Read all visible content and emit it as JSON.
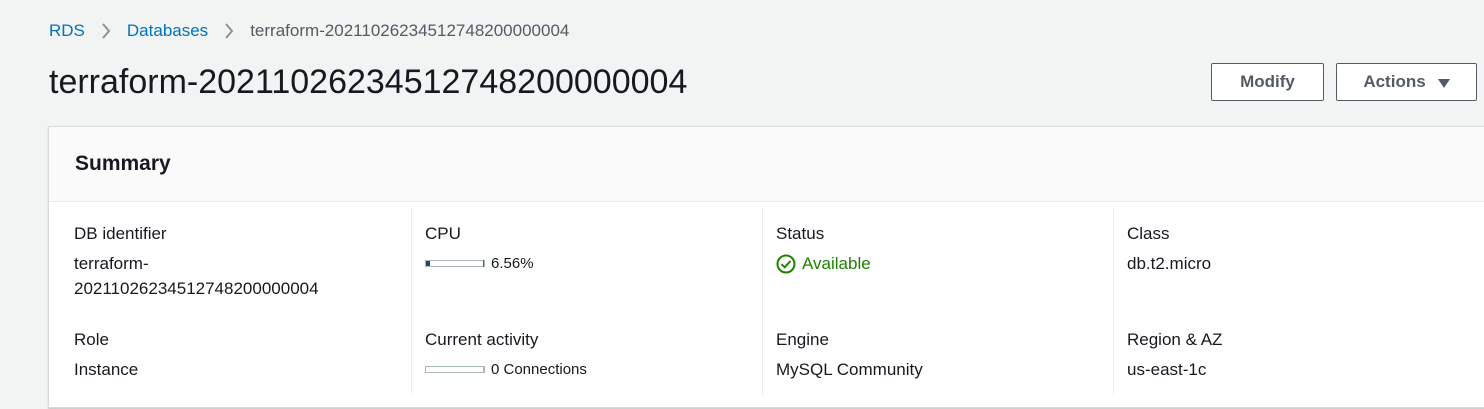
{
  "breadcrumb": {
    "items": [
      {
        "label": "RDS"
      },
      {
        "label": "Databases"
      },
      {
        "label": "terraform-20211026234512748200000004"
      }
    ]
  },
  "page": {
    "title": "terraform-20211026234512748200000004"
  },
  "toolbar": {
    "modify_label": "Modify",
    "actions_label": "Actions"
  },
  "summary": {
    "title": "Summary",
    "db_identifier": {
      "label": "DB identifier",
      "value": "terraform-\n20211026234512748200000004"
    },
    "cpu": {
      "label": "CPU",
      "value": "6.56%",
      "percent": 6.56
    },
    "status": {
      "label": "Status",
      "value": "Available",
      "color": "#1d8102"
    },
    "class": {
      "label": "Class",
      "value": "db.t2.micro"
    },
    "role": {
      "label": "Role",
      "value": "Instance"
    },
    "current_activity": {
      "label": "Current activity",
      "value": "0 Connections",
      "count": 0
    },
    "engine": {
      "label": "Engine",
      "value": "MySQL Community"
    },
    "region_az": {
      "label": "Region & AZ",
      "value": "us-east-1c"
    }
  },
  "colors": {
    "link": "#0073bb",
    "background": "#f2f3f3",
    "success": "#1d8102"
  }
}
